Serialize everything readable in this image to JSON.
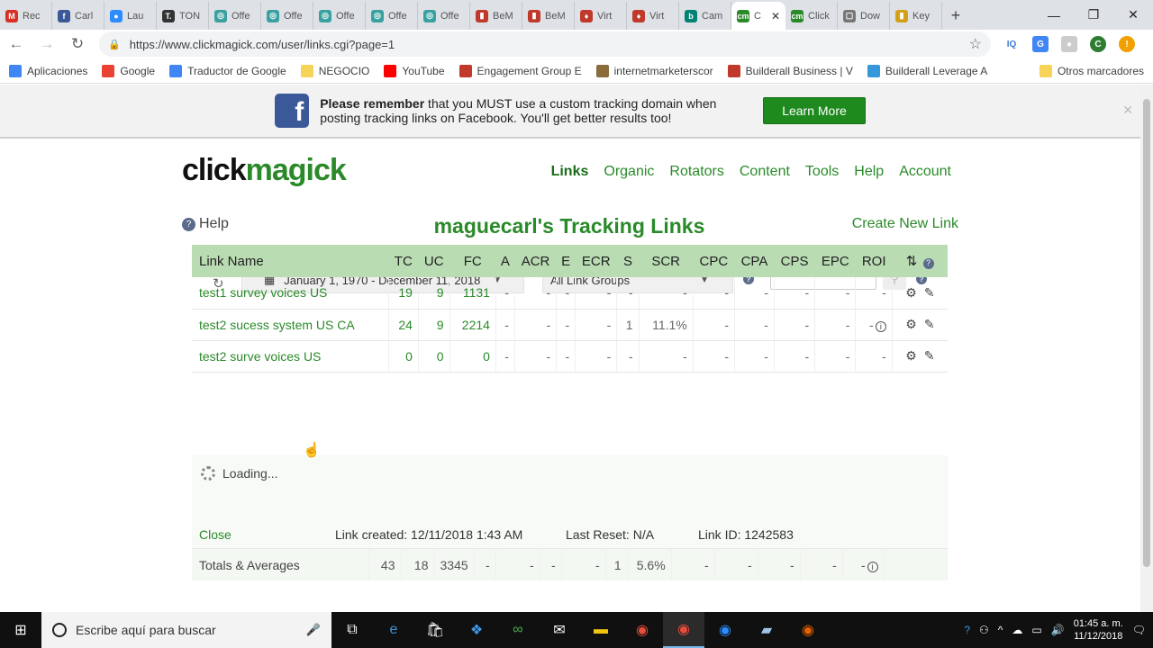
{
  "browser": {
    "tabs": [
      {
        "label": "Rec",
        "icon": "gmail-icon",
        "color": "#d93025",
        "glyph": "M"
      },
      {
        "label": "Carl",
        "icon": "facebook-icon",
        "color": "#3b5998",
        "glyph": "f"
      },
      {
        "label": "Lau",
        "icon": "zoom-icon",
        "color": "#2d8cff",
        "glyph": "●"
      },
      {
        "label": "TON",
        "icon": "t-icon",
        "color": "#333333",
        "glyph": "T."
      },
      {
        "label": "Offe",
        "icon": "offer-icon",
        "color": "#3aa0a0",
        "glyph": "◎"
      },
      {
        "label": "Offe",
        "icon": "offer-icon",
        "color": "#3aa0a0",
        "glyph": "◎"
      },
      {
        "label": "Offe",
        "icon": "offer-icon",
        "color": "#3aa0a0",
        "glyph": "◎"
      },
      {
        "label": "Offe",
        "icon": "offer-icon",
        "color": "#3aa0a0",
        "glyph": "◎"
      },
      {
        "label": "Offe",
        "icon": "offer-icon",
        "color": "#3aa0a0",
        "glyph": "◎"
      },
      {
        "label": "BeM",
        "icon": "bem-icon",
        "color": "#c0392b",
        "glyph": "▮"
      },
      {
        "label": "BeM",
        "icon": "bem-icon",
        "color": "#c0392b",
        "glyph": "▮"
      },
      {
        "label": "Virt",
        "icon": "builderall-icon",
        "color": "#c0392b",
        "glyph": "♦"
      },
      {
        "label": "Virt",
        "icon": "builderall-icon",
        "color": "#c0392b",
        "glyph": "♦"
      },
      {
        "label": "Cam",
        "icon": "bing-icon",
        "color": "#008373",
        "glyph": "b"
      },
      {
        "label": "C",
        "icon": "clickmagick-icon",
        "color": "#2a8a2a",
        "glyph": "cm",
        "active": true
      },
      {
        "label": "Click",
        "icon": "clickmagick-icon",
        "color": "#2a8a2a",
        "glyph": "cm"
      },
      {
        "label": "Dow",
        "icon": "document-icon",
        "color": "#777777",
        "glyph": "▢"
      },
      {
        "label": "Key",
        "icon": "key-icon",
        "color": "#d4a017",
        "glyph": "▮"
      }
    ],
    "url": "https://www.clickmagick.com/user/links.cgi?page=1",
    "bookmarks": [
      {
        "label": "Aplicaciones",
        "color": "#4285f4"
      },
      {
        "label": "Google",
        "color": "#ea4335"
      },
      {
        "label": "Traductor de Google",
        "color": "#4285f4"
      },
      {
        "label": "NEGOCIO",
        "color": "#f7d358"
      },
      {
        "label": "YouTube",
        "color": "#ff0000"
      },
      {
        "label": "Engagement Group E",
        "color": "#c0392b"
      },
      {
        "label": "internetmarketerscor",
        "color": "#8a6d3b"
      },
      {
        "label": "Builderall Business | V",
        "color": "#c0392b"
      },
      {
        "label": "Builderall Leverage A",
        "color": "#3498db"
      }
    ],
    "other_bookmarks": "Otros marcadores",
    "colors": {
      "accent": "#2a8a2a",
      "header_green": "#b9dcb3"
    }
  },
  "banner": {
    "bold": "Please remember",
    "text": " that you MUST use a custom tracking domain when posting tracking links on Facebook. You'll get better results too!",
    "button": "Learn More"
  },
  "header": {
    "logo_part1": "click",
    "logo_part2": "magick",
    "nav": [
      {
        "label": "Links",
        "active": true
      },
      {
        "label": "Organic"
      },
      {
        "label": "Rotators"
      },
      {
        "label": "Content"
      },
      {
        "label": "Tools"
      },
      {
        "label": "Help"
      },
      {
        "label": "Account"
      }
    ]
  },
  "page": {
    "help": "Help",
    "title": "maguecarl's Tracking Links",
    "create_new": "Create New Link",
    "date_range": "January 1, 1970 - December 11, 2018",
    "group_select": "All Link Groups"
  },
  "table": {
    "columns": [
      "Link Name",
      "TC",
      "UC",
      "FC",
      "A",
      "ACR",
      "E",
      "ECR",
      "S",
      "SCR",
      "CPC",
      "CPA",
      "CPS",
      "EPC",
      "ROI"
    ],
    "rows": [
      {
        "name": "test1 survey voices US",
        "cells": [
          "19",
          "9",
          "1131",
          "-",
          "-",
          "-",
          "-",
          "-",
          "-",
          "-",
          "-",
          "-",
          "-",
          "-"
        ],
        "roi_info": false
      },
      {
        "name": "test2 sucess system US CA",
        "cells": [
          "24",
          "9",
          "2214",
          "-",
          "-",
          "-",
          "-",
          "1",
          "11.1%",
          "-",
          "-",
          "-",
          "-",
          "-"
        ],
        "roi_info": true
      },
      {
        "name": "test2 surve voices US",
        "cells": [
          "0",
          "0",
          "0",
          "-",
          "-",
          "-",
          "-",
          "-",
          "-",
          "-",
          "-",
          "-",
          "-",
          "-"
        ],
        "roi_info": false
      }
    ],
    "detail": {
      "loading": "Loading...",
      "close": "Close",
      "created": "Link created: 12/11/2018 1:43 AM",
      "reset": "Last Reset: N/A",
      "link_id": "Link ID: 1242583"
    },
    "totals": {
      "label": "Totals & Averages",
      "cells": [
        "43",
        "18",
        "3345",
        "-",
        "-",
        "-",
        "-",
        "1",
        "5.6%",
        "-",
        "-",
        "-",
        "-",
        "-"
      ]
    }
  },
  "taskbar": {
    "search_placeholder": "Escribe aquí para buscar",
    "time": "01:45 a. m.",
    "date": "11/12/2018"
  }
}
